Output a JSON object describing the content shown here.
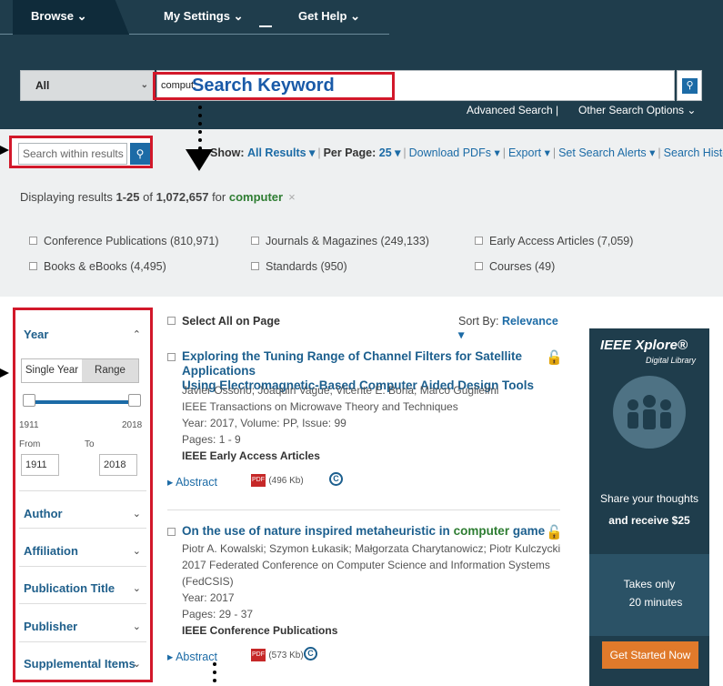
{
  "nav": {
    "browse": "Browse ⌄",
    "settings": "My Settings ⌄",
    "help": "Get Help ⌄"
  },
  "search": {
    "scope": "All",
    "query": "comput",
    "button_icon": "search-icon",
    "annotation": "Search Keyword"
  },
  "links": {
    "advanced": "Advanced Search",
    "pipe": "|",
    "other": "Other Search Options ⌄"
  },
  "within": {
    "placeholder": "Search within results"
  },
  "showbar": {
    "show_label": "Show:",
    "show_value": "All Results ▾",
    "perpage_label": "Per Page:",
    "perpage_value": "25 ▾",
    "download": "Download PDFs ▾",
    "export": "Export ▾",
    "alerts": "Set Search Alerts ▾",
    "history": "Search History",
    "sep": "|"
  },
  "summary": {
    "prefix": "Displaying results ",
    "range": "1-25",
    "of": " of ",
    "total": "1,072,657",
    "for": " for ",
    "term": "computer",
    "clear": "×"
  },
  "content_types": [
    "Conference Publications (810,971)",
    "Journals & Magazines (249,133)",
    "Early Access Articles (7,059)",
    "Books & eBooks (4,495)",
    "Standards (950)",
    "Courses (49)"
  ],
  "sidebar": {
    "year": "Year",
    "single_year": "Single Year",
    "range": "Range",
    "min": "1911",
    "max": "2018",
    "from": "From",
    "to": "To",
    "from_value": "1911",
    "to_value": "2018",
    "author": "Author",
    "affiliation": "Affiliation",
    "pubtitle": "Publication Title",
    "publisher": "Publisher",
    "supplemental": "Supplemental Items"
  },
  "results_header": {
    "select_all": "Select All on Page",
    "sort_label": "Sort By: ",
    "sort_value": "Relevance ▾"
  },
  "results": [
    {
      "title_l1": "Exploring the Tuning Range of Channel Filters for Satellite Applications",
      "title_l2": "Using Electromagnetic-Based Computer Aided Design Tools",
      "authors": "Javier Ossorio; Joaquin Vague; Vicente E. Boria; Marco Guglielmi",
      "venue": "IEEE Transactions on Microwave Theory and Techniques",
      "venue2": "",
      "year": "Year: 2017, Volume: PP, Issue: 99",
      "pages": "Pages: 1 - 9",
      "type": "IEEE Early Access Articles",
      "abstract": "Abstract",
      "size": "(496 Kb)"
    },
    {
      "title_l1_pre": "On the use of nature inspired metaheuristic in ",
      "title_l1_hl": "computer",
      "title_l1_post": " game",
      "authors": "Piotr A. Kowalski; Szymon Łukasik; Małgorzata Charytanowicz; Piotr Kulczycki",
      "venue": "2017 Federated Conference on Computer Science and Information Systems",
      "venue2": "(FedCSIS)",
      "year": "Year: 2017",
      "pages": "Pages: 29 - 37",
      "type": "IEEE Conference Publications",
      "abstract": "Abstract",
      "size": "(573 Kb)"
    }
  ],
  "ad": {
    "brand": "IEEE Xplore®",
    "sub": "Digital Library",
    "share": "Share your thoughts",
    "receive": "and receive $25",
    "takes": "Takes only",
    "minutes": "20 minutes",
    "cta": "Get Started Now"
  },
  "colors": {
    "header": "#1f3d4c",
    "accent": "#1c6ba6",
    "annotation": "#d2182a",
    "highlight": "#2e7d32"
  }
}
